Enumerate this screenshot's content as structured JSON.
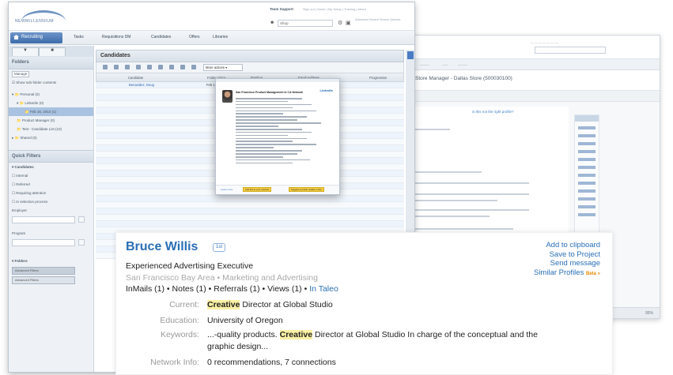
{
  "back_window": {
    "title": "Store Manager - Dallas Store (500030100)",
    "profile_link": "is this not the right profile?",
    "status_zoom": "95%"
  },
  "front_window": {
    "logo_text": "NEWMILLENNIUM",
    "team_support": "Team Support",
    "top_links": "Sign out | Home | My Setup | Training | About",
    "group_select": "Shop",
    "search_hint": "Advanced Search\nSearch Queries",
    "nav": {
      "active": "Recruiting",
      "items": [
        "Tasks",
        "Requisitions DM",
        "Candidates",
        "Offers",
        "Libraries"
      ]
    },
    "left_panel": {
      "folders_title": "Folders",
      "manage": "Manage",
      "show_subfolder": "Show sub-folder contents",
      "tree": [
        {
          "label": "Personal (0)",
          "selected": false,
          "indent": 0
        },
        {
          "label": "LinkedIn (0)",
          "selected": false,
          "indent": 1
        },
        {
          "label": "Feb 16, 2010 (1)",
          "selected": true,
          "indent": 2
        },
        {
          "label": "Product Manager (0)",
          "selected": false,
          "indent": 1
        },
        {
          "label": "Test - Candidate List (10)",
          "selected": false,
          "indent": 1
        },
        {
          "label": "Shared (0)",
          "selected": false,
          "indent": 0
        }
      ],
      "quick_filters_title": "Quick Filters",
      "filters_heading": "Candidates",
      "filters": [
        "Internal",
        "Referred",
        "Requiring attention",
        "In selection process"
      ],
      "employer_label": "Employer",
      "program_label": "Program",
      "folders_heading": "Folders",
      "advanced_button": "Advanced Filters",
      "advanced_label": "Advanced Filters"
    },
    "main": {
      "title": "Candidates",
      "more_actions": "More actions",
      "columns": [
        "Candidate",
        "Folder Since",
        "Position",
        "Email Address",
        "Progression"
      ],
      "first_row": {
        "name": "Benavidez, Doug",
        "date": "Feb 16"
      }
    },
    "popup": {
      "headline": "San Francisco Product Management in CA Network",
      "brand": "LinkedIn",
      "footer_link": "Learn more",
      "button_a": "Add this to your network",
      "button_b": "Suggest a profile update to this"
    }
  },
  "profile_card": {
    "name": "Bruce Willis",
    "badge": "1st",
    "headline": "Experienced Advertising Executive",
    "location_line": "San Francisco Bay Area • Marketing and Advertising",
    "stats": {
      "inmails": "InMails (1)",
      "notes": "Notes (1)",
      "referrals": "Referrals (1)",
      "views": "Views (1)",
      "taleo": "In Taleo",
      "sep": " • "
    },
    "actions": {
      "clipboard": "Add to clipboard",
      "project": "Save to Project",
      "message": "Send message",
      "similar": "Similar Profiles",
      "beta": "Beta »"
    },
    "current_label": "Current:",
    "current_highlight": "Creative",
    "current_rest": " Director at Global Studio",
    "education_label": "Education:",
    "education_value": "University of Oregon",
    "keywords_label": "Keywords:",
    "keywords_pre": "...-quality products. ",
    "keywords_highlight": "Creative",
    "keywords_post": " Director at Global Studio In charge of the conceptual and the",
    "keywords_line2": "graphic design...",
    "network_label": "Network Info:",
    "network_value": "0 recommendations, 7 connections"
  }
}
